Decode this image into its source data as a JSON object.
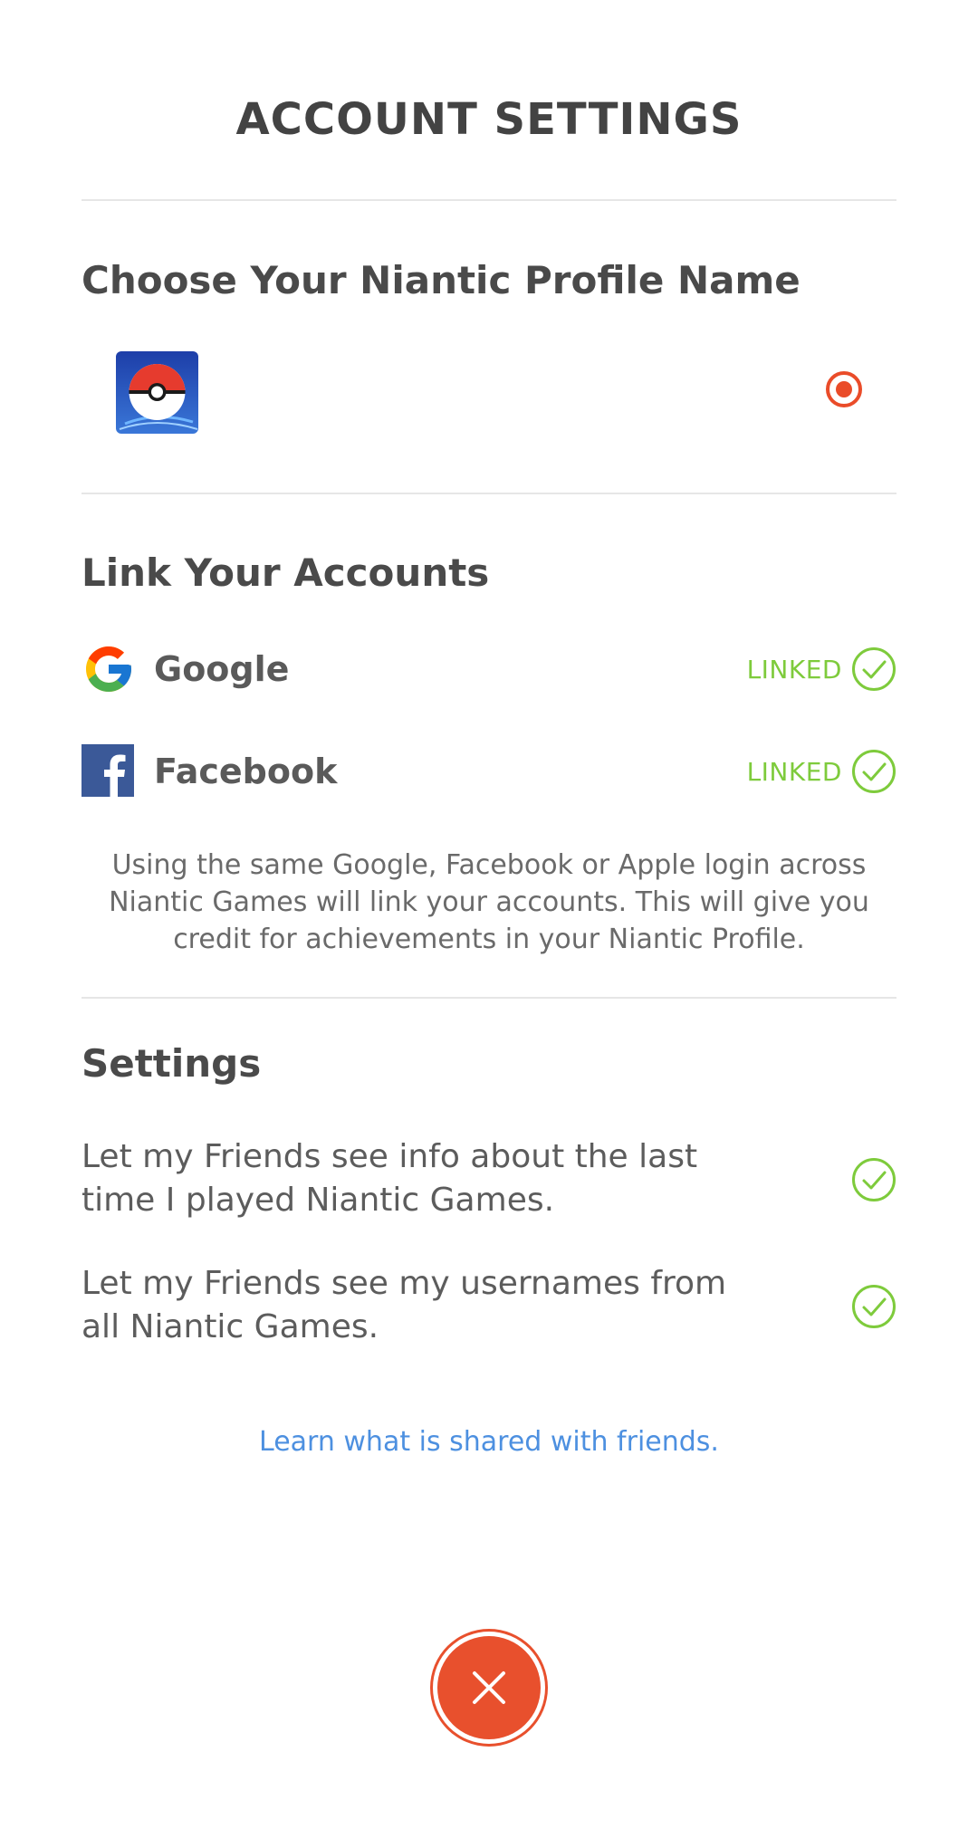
{
  "header": {
    "title": "ACCOUNT SETTINGS"
  },
  "profile_section": {
    "heading": "Choose Your Niantic Profile Name",
    "options": [
      {
        "icon": "pokemon-go-app-icon",
        "selected": true
      }
    ]
  },
  "link_section": {
    "heading": "Link Your Accounts",
    "accounts": [
      {
        "name": "Google",
        "icon": "google-icon",
        "status": "LINKED"
      },
      {
        "name": "Facebook",
        "icon": "facebook-icon",
        "status": "LINKED"
      }
    ],
    "info": "Using the same Google, Facebook or Apple login across Niantic Games will link your accounts. This will give you credit for achievements in your Niantic Profile."
  },
  "settings_section": {
    "heading": "Settings",
    "items": [
      {
        "label": "Let my Friends see info about the last time I played Niantic Games.",
        "checked": true
      },
      {
        "label": "Let my Friends see my usernames from all Niantic Games.",
        "checked": true
      }
    ]
  },
  "footer": {
    "learn_link": "Learn what is shared with friends.",
    "close_icon": "close-icon"
  },
  "colors": {
    "accent": "#e8502d",
    "linked_green": "#7ecb3c",
    "link_blue": "#4d90e0"
  }
}
